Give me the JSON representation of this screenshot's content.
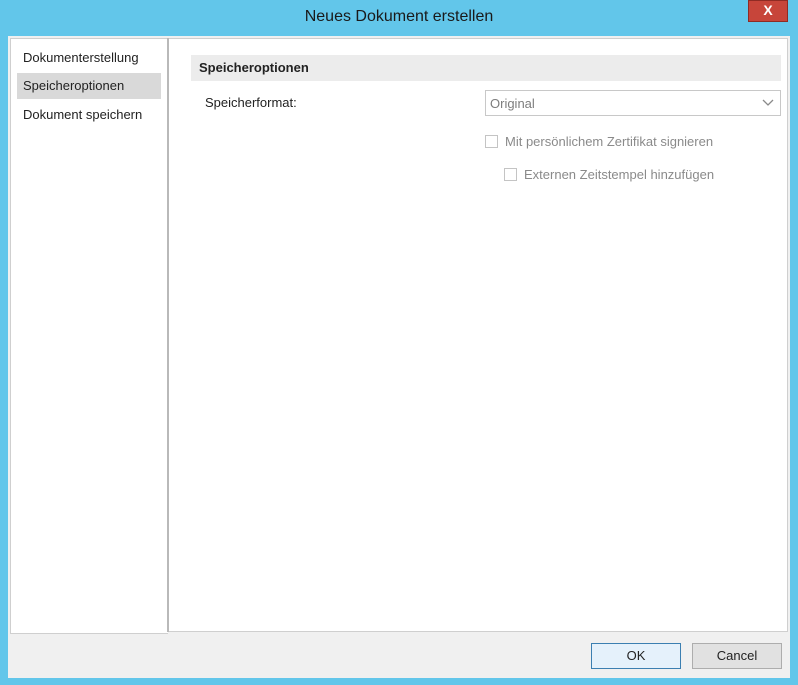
{
  "window": {
    "title": "Neues Dokument erstellen",
    "close_label": "X"
  },
  "sidebar": {
    "items": [
      {
        "label": "Dokumenterstellung",
        "selected": false
      },
      {
        "label": "Speicheroptionen",
        "selected": true
      },
      {
        "label": "Dokument speichern",
        "selected": false
      }
    ]
  },
  "main": {
    "section_title": "Speicheroptionen",
    "format_label": "Speicherformat:",
    "format_value": "Original",
    "checkboxes": [
      {
        "label": "Mit persönlichem Zertifikat signieren",
        "checked": false,
        "enabled": false
      },
      {
        "label": "Externen Zeitstempel hinzufügen",
        "checked": false,
        "enabled": false
      }
    ]
  },
  "footer": {
    "ok_label": "OK",
    "cancel_label": "Cancel"
  },
  "colors": {
    "titlebar": "#62c6ea",
    "close_button": "#c7453a",
    "selected_item": "#d9d9d9",
    "ok_border": "#3c7fb1"
  },
  "icons": {
    "close": "close-icon",
    "dropdown": "chevron-down-icon"
  }
}
